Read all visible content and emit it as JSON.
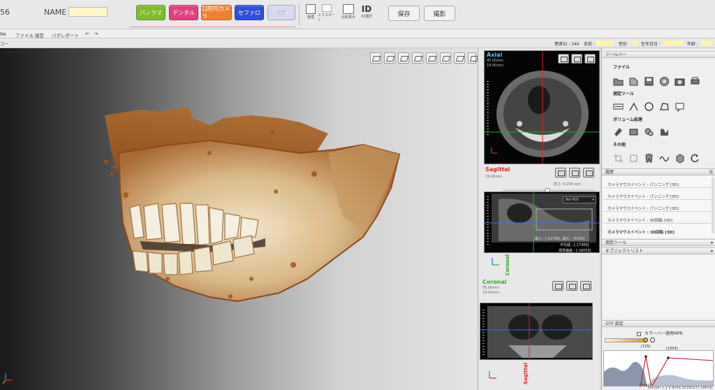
{
  "header": {
    "patient_number_partial": "56",
    "name_label": "NAME",
    "mode_buttons": [
      {
        "label": "パノラマ",
        "color": "#7dbd2a"
      },
      {
        "label": "デンタル",
        "color": "#e0417f"
      },
      {
        "label": "口腔内カメラ",
        "color": "#f08030"
      },
      {
        "label": "セファロ",
        "color": "#2e4fd8"
      },
      {
        "label": "CT",
        "color": "#d8d8ee"
      }
    ],
    "small_tools": [
      {
        "label": "整理",
        "icon": "organize-icon"
      },
      {
        "label": "エクスポート",
        "icon": "export-icon"
      }
    ],
    "compare_label": "比較表示",
    "id_label": "ID",
    "id_select_label": "ID選択",
    "save_label": "保存",
    "capture_label": "撮影"
  },
  "menu": {
    "app_name_partial": "RA",
    "items": [
      "ファイル",
      "設定",
      "バグレポート"
    ],
    "undo_icon": "undo-icon",
    "redo_icon": "redo-icon",
    "tab_partial": "コー",
    "view_label_partial": "x-x-x-x-x-x"
  },
  "patient_bar": {
    "patient_id": "患者ID : 346",
    "name_label": "名前 :",
    "sex_label": "性別",
    "dob_label": "生年月日 :",
    "age_label": "年齢 :"
  },
  "view3d": {
    "toolbar_icons": [
      "tooth-view-icon",
      "front-view-icon",
      "top-view-icon",
      "side-view-icon",
      "right-view-icon",
      "left-view-icon",
      "back-view-icon",
      "bottom-view-icon"
    ],
    "orientation_icon": "axes-icon"
  },
  "mpr": {
    "axial": {
      "title": "Axial",
      "thickness": "95.00mm",
      "range": "19.00mm",
      "color": "#3cd0ff"
    },
    "sagittal": {
      "title": "Sagittal",
      "subtitle": "19.00mm",
      "slice_label": "厚さ: 0.200 mm",
      "dropdown": "Ref ROI",
      "min_max": "最小 : [-52768], 最大 : [4539]",
      "mean": "平均値 : [-17989]",
      "stddev": "標準偏差 : [-16059]",
      "side_label": "Coronal",
      "color": "#e02020"
    },
    "coronal": {
      "title": "Coronal",
      "thickness": "95.00mm",
      "range": "19.00mm",
      "side_label": "Sagittal",
      "color": "#2fb12f"
    }
  },
  "right_panel": {
    "toolbar_header": "ツールバー",
    "groups": [
      {
        "label": "ファイル",
        "icons": [
          "open-folder-icon",
          "export-file-icon",
          "save-disk-icon",
          "burn-disc-icon",
          "camera-icon",
          "print-icon"
        ]
      },
      {
        "label": "測定ツール",
        "icons": [
          "ww-wl-icon",
          "angle-icon",
          "circle-icon",
          "polygon-icon",
          "annotation-icon"
        ]
      },
      {
        "label": "ボリューム処理",
        "icons": [
          "airway-icon",
          "slab-icon",
          "sculpt-icon",
          "curve-icon"
        ]
      },
      {
        "label": "その他",
        "icons": [
          "crop-icon",
          "rotate-icon",
          "tooth-icon",
          "wave-icon",
          "implant-icon",
          "reset-icon"
        ]
      }
    ],
    "history_header": "履歴",
    "history_items": [
      "カメラマウスイベント : パンニング [3D]",
      "カメラマウスイベント : パンニング [3D]",
      "カメラマウスイベント : パンニング [3D]",
      "カメラマウスイベント : 3D回転 [3D]",
      "カメラマウスイベント : 3D回転 [3D]"
    ],
    "measure_header": "測定ツール",
    "object_header": "オブジェクトリスト",
    "otf_header": "OTF 設定",
    "colorbar_label": "カラーバー適用MPR",
    "otf_values": {
      "top_left": "[725]",
      "top_right": "[1854]",
      "bottom": "[754]"
    }
  },
  "version_text": "Version 1.2.5 Build 201A0227 official"
}
